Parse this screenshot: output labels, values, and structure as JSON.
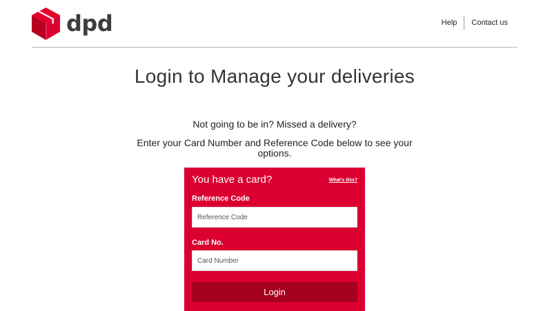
{
  "brand": {
    "name": "dpd",
    "logo_icon": "dpd-cube-logo-icon",
    "color": "#dc0032",
    "dark_color": "#a5001e"
  },
  "nav": {
    "help": "Help",
    "contact": "Contact us"
  },
  "page": {
    "title": "Login to Manage your deliveries",
    "intro_line1": "Not going to be in? Missed a delivery?",
    "intro_line2": "Enter your Card Number and Reference Code below to see your options."
  },
  "card_form": {
    "heading": "You have a card?",
    "whats_this": "What's this?",
    "reference_label": "Reference Code",
    "reference_placeholder": "Reference Code",
    "card_label": "Card No.",
    "card_placeholder": "Card Number",
    "login_label": "Login"
  }
}
